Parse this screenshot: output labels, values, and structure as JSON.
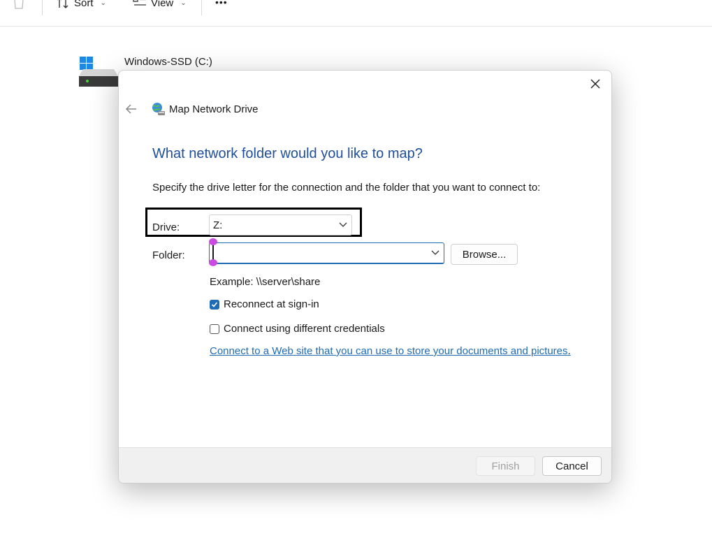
{
  "toolbar": {
    "sort_label": "Sort",
    "view_label": "View",
    "more_label": "•••"
  },
  "drive_tile": {
    "label": "Windows-SSD (C:)"
  },
  "dialog": {
    "title": "Map Network Drive",
    "heading": "What network folder would you like to map?",
    "instruction": "Specify the drive letter for the connection and the folder that you want to connect to:",
    "drive_label": "Drive:",
    "drive_value": "Z:",
    "folder_label": "Folder:",
    "folder_value": "",
    "browse_label": "Browse...",
    "example": "Example: \\\\server\\share",
    "reconnect_label": "Reconnect at sign-in",
    "reconnect_checked": true,
    "credentials_label": "Connect using different credentials",
    "credentials_checked": false,
    "link_text": "Connect to a Web site that you can use to store your documents and pictures",
    "link_period": ".",
    "finish_label": "Finish",
    "cancel_label": "Cancel"
  },
  "colors": {
    "heading": "#1f4e9a",
    "accent": "#1f6bb5",
    "highlight_border": "#000000",
    "selection_handle": "#c94be0"
  }
}
